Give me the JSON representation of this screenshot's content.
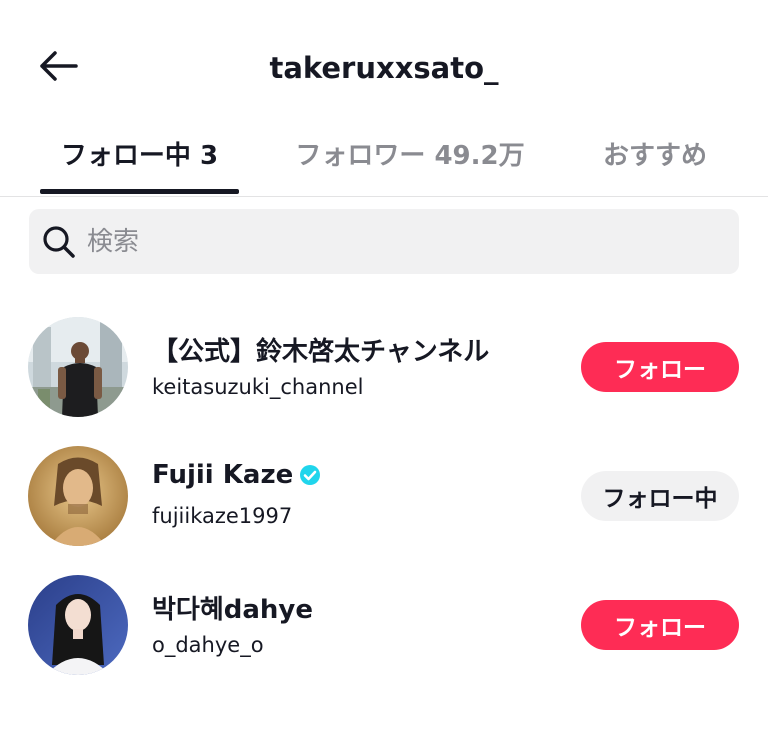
{
  "header": {
    "title": "takeruxxsato_",
    "back_icon": "arrow-left-icon"
  },
  "tabs": [
    {
      "label": "フォロー中 3",
      "active": true
    },
    {
      "label": "フォロワー 49.2万",
      "active": false
    },
    {
      "label": "おすすめ",
      "active": false
    }
  ],
  "search": {
    "placeholder": "検索",
    "value": ""
  },
  "users": [
    {
      "name": "【公式】鈴木啓太チャンネル",
      "handle": "keitasuzuki_channel",
      "verified": false,
      "button_label": "フォロー",
      "button_style": "primary"
    },
    {
      "name": "Fujii Kaze",
      "handle": "fujiikaze1997",
      "verified": true,
      "button_label": "フォロー中",
      "button_style": "secondary"
    },
    {
      "name": "박다혜dahye",
      "handle": "o_dahye_o",
      "verified": false,
      "button_label": "フォロー",
      "button_style": "primary"
    }
  ],
  "colors": {
    "accent": "#fe2c55",
    "verified": "#20d5ec",
    "text_primary": "#161823",
    "text_secondary": "#8a8b91",
    "search_bg": "#f1f1f2"
  }
}
